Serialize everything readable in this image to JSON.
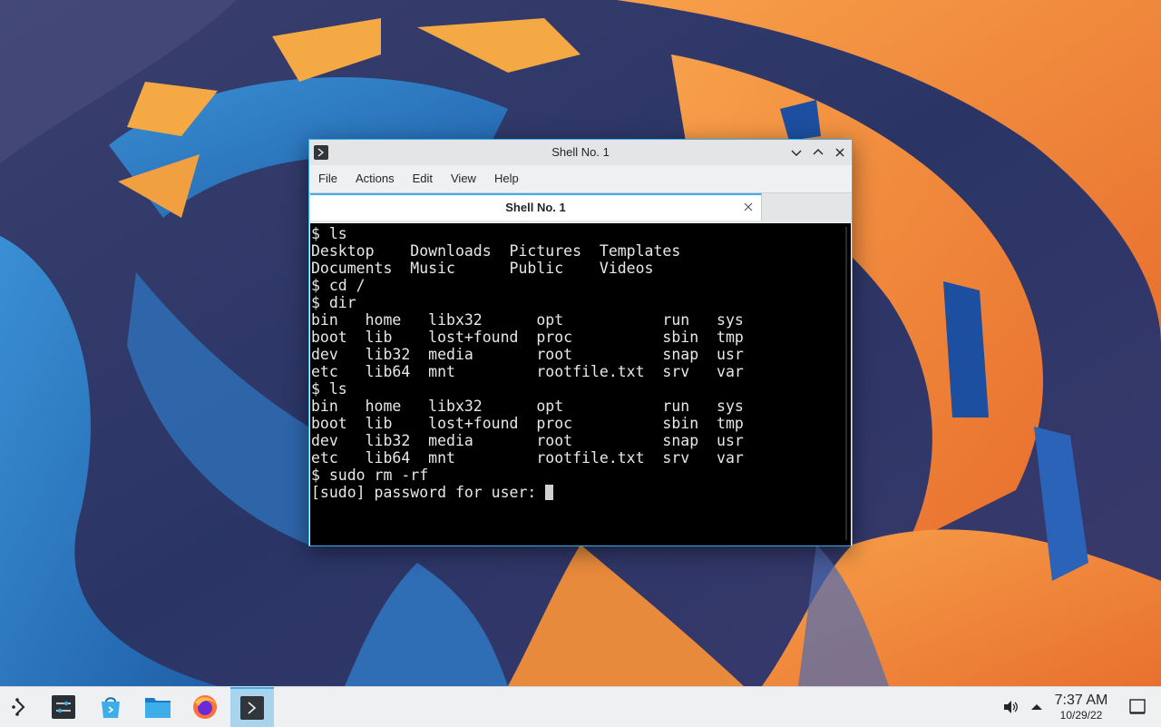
{
  "window": {
    "title": "Shell No. 1",
    "menu": [
      "File",
      "Actions",
      "Edit",
      "View",
      "Help"
    ],
    "tab_label": "Shell No. 1"
  },
  "terminal": {
    "lines": [
      "$ ls",
      "Desktop    Downloads  Pictures  Templates",
      "Documents  Music      Public    Videos",
      "$ cd /",
      "$ dir",
      "bin   home   libx32      opt           run   sys",
      "boot  lib    lost+found  proc          sbin  tmp",
      "dev   lib32  media       root          snap  usr",
      "etc   lib64  mnt         rootfile.txt  srv   var",
      "$ ls",
      "bin   home   libx32      opt           run   sys",
      "boot  lib    lost+found  proc          sbin  tmp",
      "dev   lib32  media       root          snap  usr",
      "etc   lib64  mnt         rootfile.txt  srv   var",
      "$ sudo rm -rf",
      "[sudo] password for user: "
    ]
  },
  "taskbar": {
    "apps": [
      {
        "name": "application-launcher-icon"
      },
      {
        "name": "system-settings-icon"
      },
      {
        "name": "discover-store-icon"
      },
      {
        "name": "file-manager-icon"
      },
      {
        "name": "firefox-icon"
      },
      {
        "name": "konsole-icon"
      }
    ],
    "clock_time": "7:37 AM",
    "clock_date": "10/29/22"
  },
  "colors": {
    "accent": "#3daee9",
    "terminal_bg": "#000000",
    "wallpaper_orange": "#f0883a",
    "wallpaper_blue": "#2f7fc4"
  }
}
